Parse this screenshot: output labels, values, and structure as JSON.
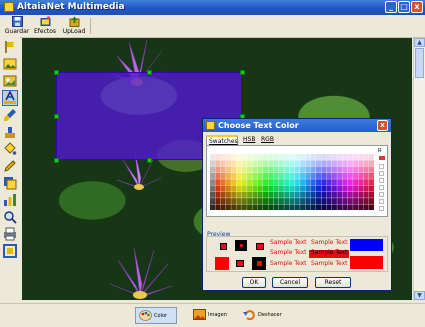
{
  "window": {
    "title": "AltaiaNet Multimedia",
    "minimize": "_",
    "maximize": "□",
    "close": "x"
  },
  "toolbar": {
    "guardar": "Guardar",
    "efectos": "Efectos",
    "upload": "UpLoad"
  },
  "left_tools": [
    "select-tool",
    "crop-tool",
    "image-tool",
    "text-color-tool",
    "paint-tool",
    "save-tool",
    "fill-tool",
    "pencil-tool",
    "layer-tool",
    "chart-tool",
    "zoom-tool",
    "print-tool",
    "frame-tool"
  ],
  "bottom": {
    "color_label": "Color",
    "imagen_label": "Imagen",
    "deshacer_label": "Deshacer"
  },
  "dialog": {
    "title": "Choose Text Color",
    "close": "x",
    "tabs": [
      "Swatches",
      "HSB",
      "RGB"
    ],
    "recent_label": "R",
    "preview_title": "Preview",
    "sample_text": "Sample Text",
    "ok": "OK",
    "cancel": "Cancel",
    "reset": "Reset"
  },
  "colors": {
    "accent_blue": "#2357c4",
    "selection": "#5218d6",
    "handle": "#12d212",
    "preview_text": "#e01010",
    "preview_blue": "#0000ff",
    "preview_red": "#ff0000"
  }
}
